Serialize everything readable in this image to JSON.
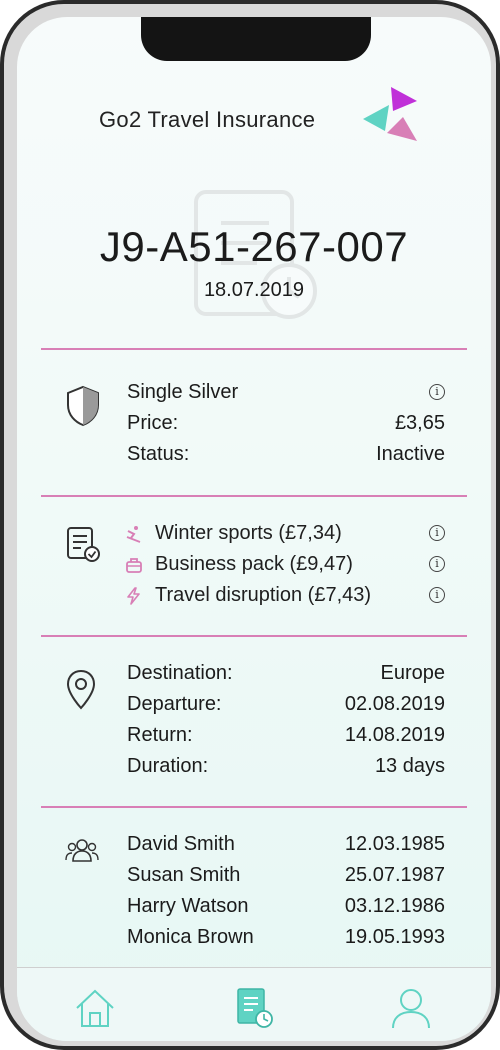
{
  "app": {
    "brand_name": "Go2 Travel Insurance"
  },
  "policy": {
    "number": "J9-A51-267-007",
    "date": "18.07.2019"
  },
  "plan": {
    "icon": "shield-icon",
    "name": "Single Silver",
    "price_label": "Price:",
    "price_value": "£3,65",
    "status_label": "Status:",
    "status_value": "Inactive"
  },
  "addons": {
    "icon": "document-check-icon",
    "items": [
      {
        "icon": "ski-icon",
        "label": "Winter sports (£7,34)"
      },
      {
        "icon": "briefcase-icon",
        "label": "Business pack (£9,47)"
      },
      {
        "icon": "lightning-icon",
        "label": "Travel disruption (£7,43)"
      }
    ]
  },
  "trip": {
    "icon": "location-pin-icon",
    "rows": [
      {
        "label": "Destination:",
        "value": "Europe"
      },
      {
        "label": "Departure:",
        "value": "02.08.2019"
      },
      {
        "label": "Return:",
        "value": "14.08.2019"
      },
      {
        "label": "Duration:",
        "value": "13 days"
      }
    ]
  },
  "travellers": {
    "icon": "group-icon",
    "rows": [
      {
        "name": "David Smith",
        "dob": "12.03.1985"
      },
      {
        "name": "Susan Smith",
        "dob": "25.07.1987"
      },
      {
        "name": "Harry Watson",
        "dob": "03.12.1986"
      },
      {
        "name": "Monica Brown",
        "dob": "19.05.1993"
      }
    ]
  },
  "tabbar": {
    "tabs": [
      {
        "icon": "home-icon",
        "active": false
      },
      {
        "icon": "policy-history-icon",
        "active": true
      },
      {
        "icon": "profile-icon",
        "active": false
      }
    ]
  },
  "colors": {
    "accent_pink": "#d87fb6",
    "accent_teal": "#5fd3c3",
    "accent_magenta": "#c030d8"
  }
}
